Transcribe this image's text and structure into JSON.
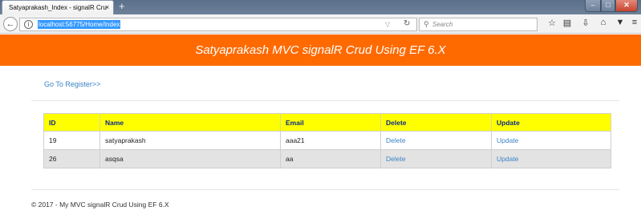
{
  "browser": {
    "tab_title": "Satyaprakash_Index - signalR Cru",
    "tab_close": "×",
    "new_tab": "+",
    "url": "localhost:56775/Home/Index",
    "search_placeholder": "Search",
    "window_buttons": {
      "minimize": "–",
      "maximize": "□",
      "close": "✕"
    }
  },
  "page": {
    "header_title": "Satyaprakash MVC signalR Crud Using EF 6.X",
    "register_link": "Go To Register>>",
    "table": {
      "columns": [
        "ID",
        "Name",
        "Email",
        "Delete",
        "Update"
      ],
      "rows": [
        {
          "id": "19",
          "name": "satyaprakash",
          "email": "aaa21",
          "delete": "Delete",
          "update": "Update"
        },
        {
          "id": "26",
          "name": "asqsa",
          "email": "aa",
          "delete": "Delete",
          "update": "Update"
        }
      ]
    },
    "footer": "© 2017 - My MVC signalR Crud Using EF 6.X"
  },
  "colors": {
    "header_bg": "#ff6a00",
    "table_header_bg": "#ffff00",
    "link": "#3a84c5"
  }
}
